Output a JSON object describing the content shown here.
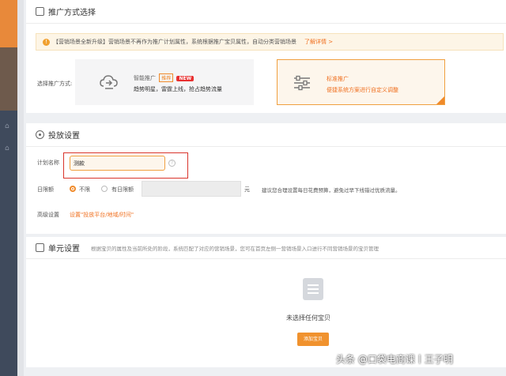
{
  "sections": {
    "promo": "推广方式选择",
    "delivery": "投放设置",
    "unit": "单元设置"
  },
  "notice": {
    "text": "【营销场景全新升级】营销场景不再作为推广计划属性，系统根据推广宝贝属性，自动分类营销场景",
    "more": "了解详情 >"
  },
  "promo": {
    "label": "选择推广方式:",
    "smart": {
      "name": "智能推广",
      "tag": "推荐",
      "badge": "NEW",
      "desc": "趋势明星，雷霆上线，抢占趋势流量"
    },
    "standard": {
      "name": "标准推广",
      "desc": "便捷系统方案进行自定义调整"
    }
  },
  "delivery": {
    "plan_label": "计划名称",
    "plan_value": "测款",
    "budget_label": "日限额",
    "opt_unlimited": "不限",
    "opt_limited": "有日限额",
    "unit": "元",
    "budget_hint": "建议您合理设置每日花费预算，避免过早下线错过优质流量。",
    "advanced_label": "高级设置",
    "advanced_link": "设置\"投放平台/地域/时间\""
  },
  "unit": {
    "desc": "根据宝贝的属性及当前所处的阶段，系统匹配了对应的营销场景，您可在首页左侧一营销场景入口进行不同营销场景的宝贝管理",
    "empty": "未选择任何宝贝",
    "add_button": "添加宝贝"
  },
  "watermark": "头条 @口袋电商课丨王子明",
  "colors": {
    "accent": "#f08a2a",
    "highlight_border": "#d9342b",
    "sidebar": "#3f4a5c"
  }
}
